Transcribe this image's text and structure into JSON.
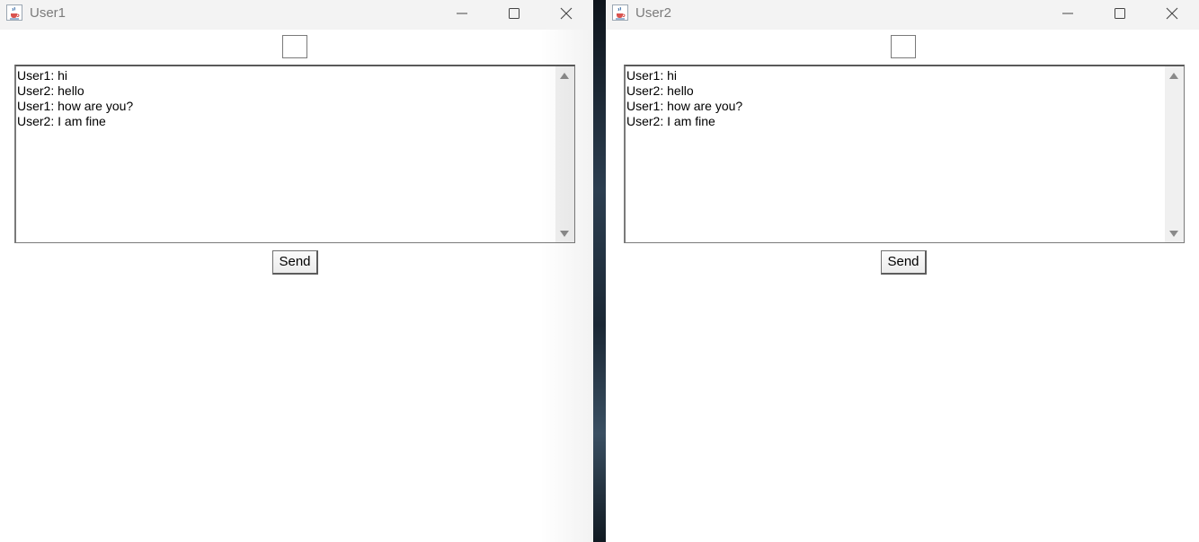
{
  "desktop": {
    "windows": [
      {
        "title": "User1",
        "chat_messages": [
          "User1: hi",
          "User2: hello",
          "User1: how are you?",
          "User2: I am fine"
        ],
        "input_value": "",
        "send_label": "Send"
      },
      {
        "title": "User2",
        "chat_messages": [
          "User1: hi",
          "User2: hello",
          "User1: how are you?",
          "User2: I am fine"
        ],
        "input_value": "",
        "send_label": "Send"
      }
    ]
  },
  "icons": {
    "app": "java-coffee-cup-icon",
    "minimize": "minimize-icon",
    "maximize": "maximize-icon",
    "close": "close-icon",
    "scroll_up": "scroll-up-arrow-icon",
    "scroll_down": "scroll-down-arrow-icon"
  },
  "colors": {
    "titlebar_bg": "#f3f3f3",
    "title_text": "#7b7b7b",
    "window_bg": "#ffffff",
    "scrollbar_bg": "#f0f0f0"
  }
}
